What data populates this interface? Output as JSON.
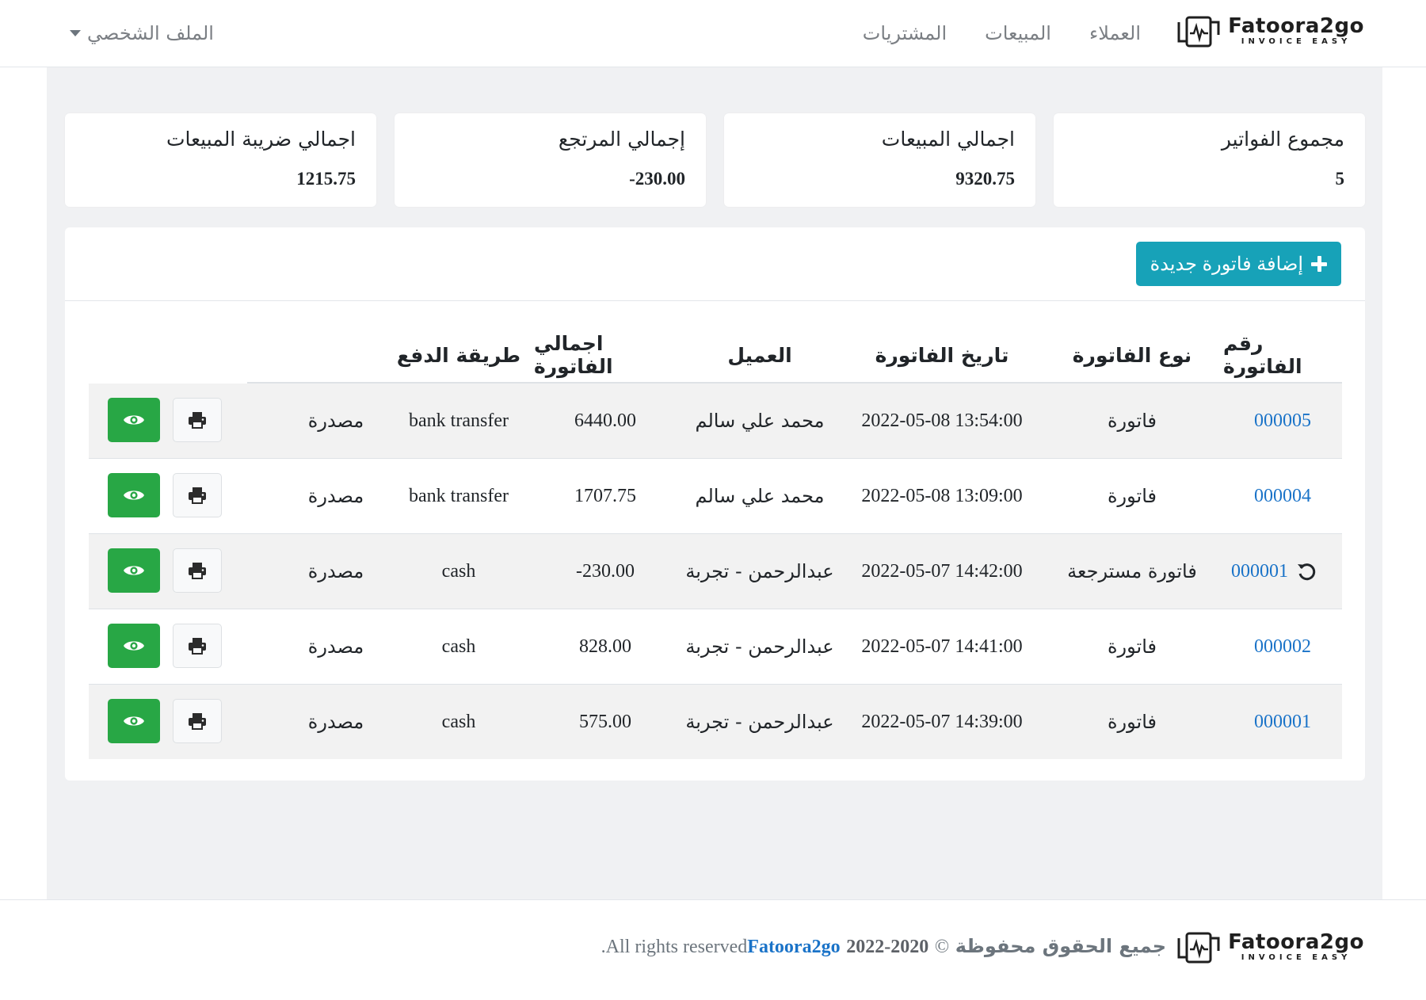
{
  "brand": {
    "name": "Fatoora2go",
    "tagline": "INVOICE EASY"
  },
  "nav": {
    "links": [
      "العملاء",
      "المبيعات",
      "المشتريات"
    ],
    "profile_label": "الملف الشخصي"
  },
  "stats": [
    {
      "label": "مجموع الفواتير",
      "value": "5"
    },
    {
      "label": "اجمالي المبيعات",
      "value": "9320.75"
    },
    {
      "label": "إجمالي المرتجع",
      "value": "-230.00"
    },
    {
      "label": "اجمالي ضريبة المبيعات",
      "value": "1215.75"
    }
  ],
  "add_invoice_label": "إضافة فاتورة جديدة",
  "table": {
    "headers": {
      "number": "رقم الفاتورة",
      "type": "نوع الفاتورة",
      "date": "تاريخ الفاتورة",
      "client": "العميل",
      "total": "اجمالي الفاتورة",
      "payment": "طريقة الدفع"
    },
    "rows": [
      {
        "number": "000005",
        "type": "فاتورة",
        "date": "2022-05-08 13:54:00",
        "client": "محمد علي سالم",
        "total": "6440.00",
        "payment": "bank transfer",
        "status": "مصدرة",
        "is_return": false
      },
      {
        "number": "000004",
        "type": "فاتورة",
        "date": "2022-05-08 13:09:00",
        "client": "محمد علي سالم",
        "total": "1707.75",
        "payment": "bank transfer",
        "status": "مصدرة",
        "is_return": false
      },
      {
        "number": "000001",
        "type": "فاتورة مسترجعة",
        "date": "2022-05-07 14:42:00",
        "client": "عبدالرحمن - تجربة",
        "total": "-230.00",
        "payment": "cash",
        "status": "مصدرة",
        "is_return": true
      },
      {
        "number": "000002",
        "type": "فاتورة",
        "date": "2022-05-07 14:41:00",
        "client": "عبدالرحمن - تجربة",
        "total": "828.00",
        "payment": "cash",
        "status": "مصدرة",
        "is_return": false
      },
      {
        "number": "000001",
        "type": "فاتورة",
        "date": "2022-05-07 14:39:00",
        "client": "عبدالرحمن - تجربة",
        "total": "575.00",
        "payment": "cash",
        "status": "مصدرة",
        "is_return": false
      }
    ]
  },
  "footer": {
    "rights_ar": "جميع الحقوق محفوظة",
    "copyright": "©",
    "years": "2020-2022",
    "rights_en": "All rights reserved",
    "brand_link": "Fatoora2go",
    "period": "."
  },
  "colors": {
    "accent": "#17a2b8",
    "success": "#28a745",
    "link": "#1a73c8",
    "background": "#f0f1f3"
  }
}
